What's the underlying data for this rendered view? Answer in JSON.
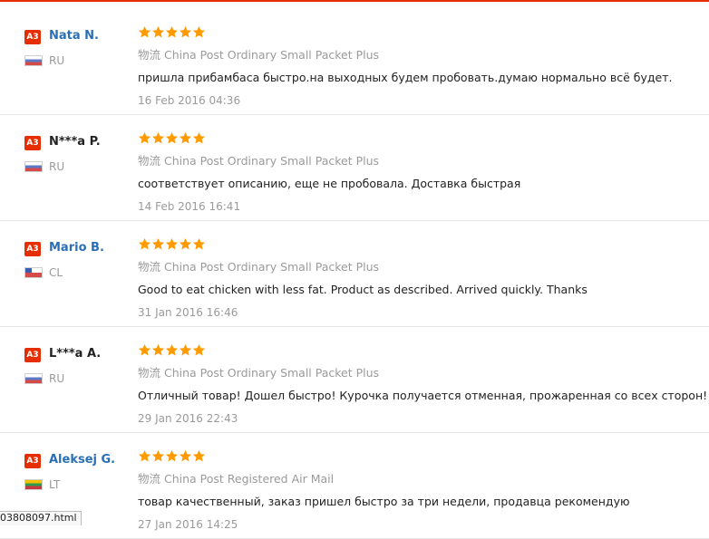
{
  "colors": {
    "accent": "#e62e04",
    "star": "#ff9a00",
    "link": "#2a6fb6",
    "muted": "#9a9a9a"
  },
  "reviews": [
    {
      "badge": "A3",
      "name": "Nata N.",
      "name_is_link": true,
      "flag": "flag-ru",
      "country": "RU",
      "rating": 5,
      "shipping_zh": "物流",
      "shipping": "China Post Ordinary Small Packet Plus",
      "comment": "пришла прибамбаса быстро.на выходных будем пробовать.думаю нормально всё будет.",
      "date": "16 Feb 2016 04:36"
    },
    {
      "badge": "A3",
      "name": "N***a P.",
      "name_is_link": false,
      "flag": "flag-ru",
      "country": "RU",
      "rating": 5,
      "shipping_zh": "物流",
      "shipping": "China Post Ordinary Small Packet Plus",
      "comment": "соответствует описанию, еще не пробовала. Доставка быстрая",
      "date": "14 Feb 2016 16:41"
    },
    {
      "badge": "A3",
      "name": "Mario B.",
      "name_is_link": true,
      "flag": "flag-cl",
      "country": "CL",
      "rating": 5,
      "shipping_zh": "物流",
      "shipping": "China Post Ordinary Small Packet Plus",
      "comment": "Good to eat chicken with less fat. Product as described. Arrived quickly. Thanks",
      "date": "31 Jan 2016 16:46"
    },
    {
      "badge": "A3",
      "name": "L***a A.",
      "name_is_link": false,
      "flag": "flag-ru",
      "country": "RU",
      "rating": 5,
      "shipping_zh": "物流",
      "shipping": "China Post Ordinary Small Packet Plus",
      "comment": "Отличный товар! Дошел быстро! Курочка получается отменная, прожаренная со всех сторон!",
      "date": "29 Jan 2016 22:43"
    },
    {
      "badge": "A3",
      "name": "Aleksej G.",
      "name_is_link": true,
      "flag": "flag-lt",
      "country": "LT",
      "rating": 5,
      "shipping_zh": "物流",
      "shipping": "China Post Registered Air Mail",
      "comment": "товар качественный, заказ пришел быстро за три недели, продавца рекомендую",
      "date": "27 Jan 2016 14:25"
    }
  ],
  "status_bar": {
    "url_fragment": "03808097.html"
  }
}
